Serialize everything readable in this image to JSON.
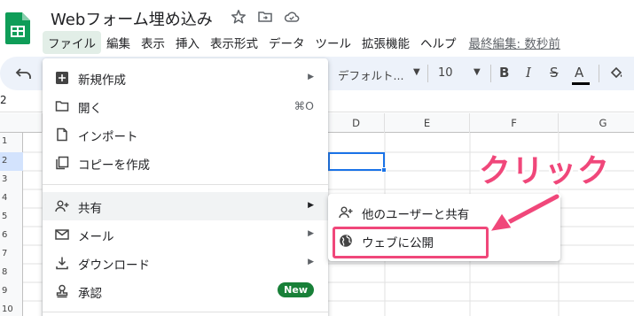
{
  "document": {
    "title": "Webフォーム埋め込み"
  },
  "menubar": {
    "items": [
      "ファイル",
      "編集",
      "表示",
      "挿入",
      "表示形式",
      "データ",
      "ツール",
      "拡張機能",
      "ヘルプ"
    ],
    "last_edit": "最終編集: 数秒前"
  },
  "toolbar": {
    "font": "デフォルト...",
    "font_size": "10",
    "bold": "B",
    "italic": "I",
    "strikethrough": "S",
    "text_color": "A"
  },
  "grid": {
    "namebox": "2",
    "columns": [
      "D",
      "E",
      "F",
      "G"
    ],
    "rows": [
      "1",
      "2",
      "3",
      "4",
      "5",
      "6",
      "7",
      "8",
      "9",
      "10"
    ]
  },
  "file_menu": {
    "items": [
      {
        "label": "新規作成",
        "icon": "new-icon",
        "has_submenu": true
      },
      {
        "label": "開く",
        "icon": "folder-icon",
        "shortcut": "⌘O"
      },
      {
        "label": "インポート",
        "icon": "import-icon"
      },
      {
        "label": "コピーを作成",
        "icon": "copy-icon"
      },
      {
        "label": "共有",
        "icon": "share-person-icon",
        "has_submenu": true
      },
      {
        "label": "メール",
        "icon": "mail-icon",
        "has_submenu": true
      },
      {
        "label": "ダウンロード",
        "icon": "download-icon",
        "has_submenu": true
      },
      {
        "label": "承認",
        "icon": "approval-icon",
        "badge": "New"
      }
    ]
  },
  "share_submenu": {
    "items": [
      {
        "label": "他のユーザーと共有",
        "icon": "share-person-icon"
      },
      {
        "label": "ウェブに公開",
        "icon": "globe-icon"
      }
    ]
  },
  "annotation": {
    "text": "クリック",
    "color": "#f0477a"
  },
  "colors": {
    "selection": "#1a73e8",
    "menu_active": "#e2eee7",
    "badge": "#188038",
    "toolbar_bg": "#edf2fa"
  }
}
